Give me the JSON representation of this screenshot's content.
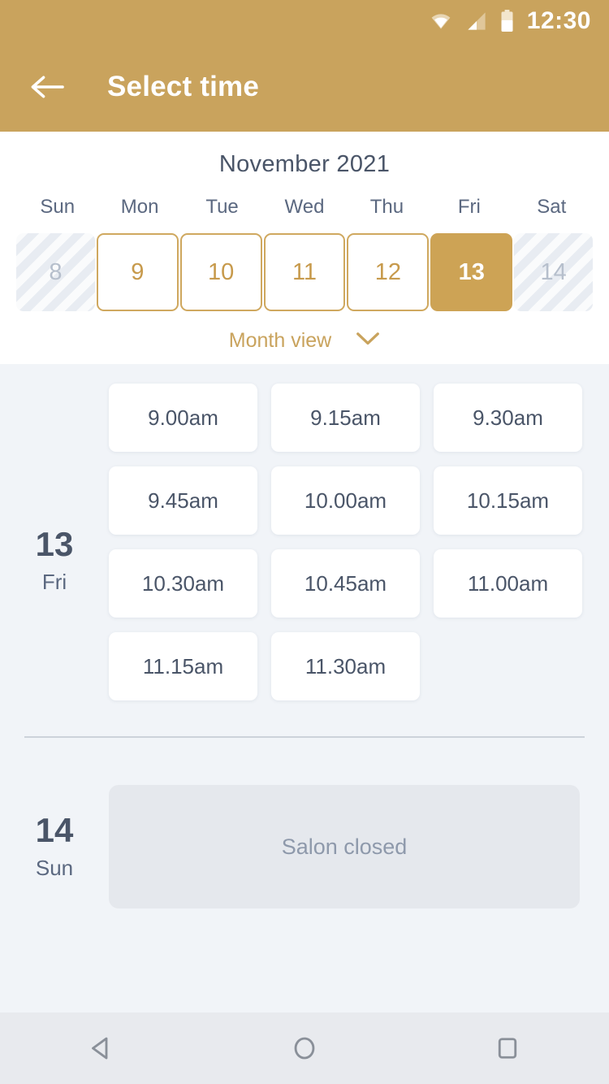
{
  "status_bar": {
    "time": "12:30",
    "icons": [
      "wifi-icon",
      "cellular-signal-icon",
      "battery-icon"
    ]
  },
  "app_bar": {
    "back_icon": "back-arrow-icon",
    "title": "Select time"
  },
  "calendar": {
    "month_label": "November 2021",
    "weekdays": [
      "Sun",
      "Mon",
      "Tue",
      "Wed",
      "Thu",
      "Fri",
      "Sat"
    ],
    "days": [
      {
        "number": "8",
        "state": "disabled"
      },
      {
        "number": "9",
        "state": "available"
      },
      {
        "number": "10",
        "state": "available"
      },
      {
        "number": "11",
        "state": "available"
      },
      {
        "number": "12",
        "state": "available"
      },
      {
        "number": "13",
        "state": "selected"
      },
      {
        "number": "14",
        "state": "disabled"
      }
    ],
    "view_toggle_label": "Month view",
    "view_toggle_icon": "chevron-down-icon"
  },
  "schedule": [
    {
      "day_number": "13",
      "day_name": "Fri",
      "slots": [
        "9.00am",
        "9.15am",
        "9.30am",
        "9.45am",
        "10.00am",
        "10.15am",
        "10.30am",
        "10.45am",
        "11.00am",
        "11.15am",
        "11.30am"
      ],
      "closed": false
    },
    {
      "day_number": "14",
      "day_name": "Sun",
      "slots": [],
      "closed": true,
      "closed_message": "Salon closed"
    }
  ],
  "nav_bar": {
    "back_label": "back-triangle-icon",
    "home_label": "home-circle-icon",
    "recents_label": "recents-square-icon"
  },
  "colors": {
    "brand_gold": "#c9a35d",
    "gold_outline": "#cfa85f",
    "selected_gold": "#cda355",
    "text_slate": "#4a5568",
    "background": "#f1f4f8",
    "disabled_gray": "#eceff4",
    "closed_card": "#e5e8ed"
  }
}
